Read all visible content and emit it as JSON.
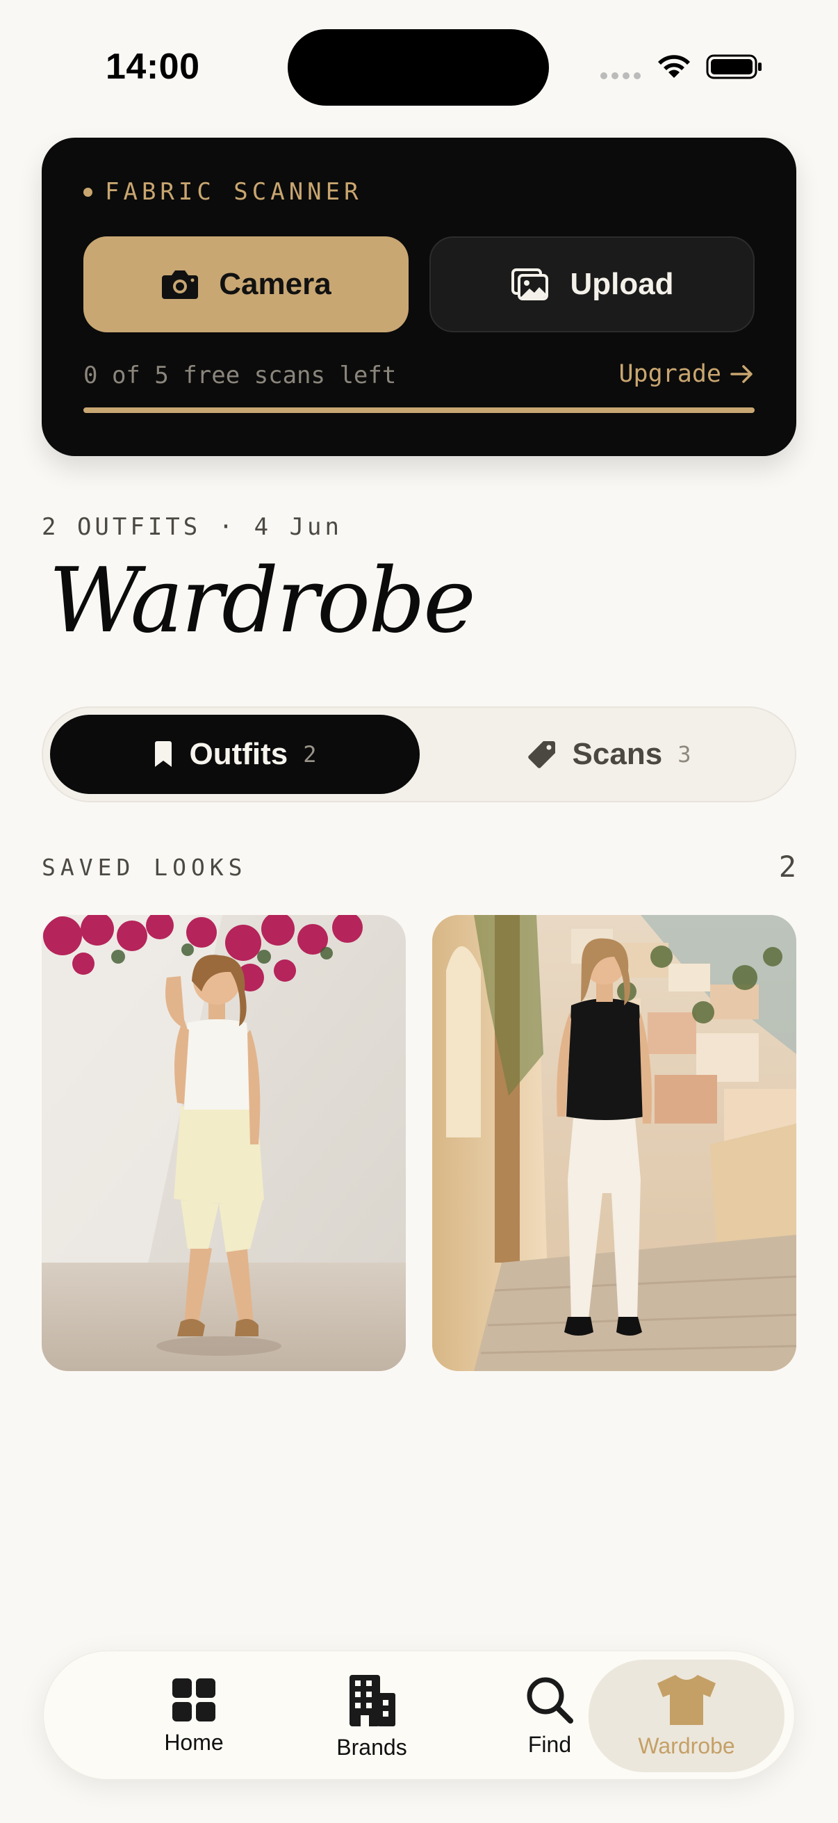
{
  "status_bar": {
    "time": "14:00"
  },
  "scanner": {
    "label": "FABRIC SCANNER",
    "camera_label": "Camera",
    "upload_label": "Upload",
    "scans_left": "0 of 5 free scans left",
    "upgrade_label": "Upgrade",
    "progress_fraction": 1.0,
    "accent_color": "#c9a773"
  },
  "header": {
    "meta": "2 OUTFITS · 4 Jun",
    "title": "Wardrobe"
  },
  "segments": [
    {
      "label": "Outfits",
      "count": "2",
      "icon": "bookmark-icon",
      "selected": true
    },
    {
      "label": "Scans",
      "count": "3",
      "icon": "tag-icon",
      "selected": false
    }
  ],
  "saved_looks": {
    "label": "SAVED LOOKS",
    "count": "2",
    "items": [
      {
        "image": "woman in white tank top and pale yellow shorts against white wall with pink bougainvillea"
      },
      {
        "image": "woman in black sleeveless blouse and white trousers on steps of a hillside village"
      }
    ]
  },
  "tab_bar": {
    "items": [
      {
        "label": "Home",
        "icon": "grid-icon",
        "active": false
      },
      {
        "label": "Brands",
        "icon": "building-icon",
        "active": false
      },
      {
        "label": "Find",
        "icon": "search-icon",
        "active": false
      },
      {
        "label": "Wardrobe",
        "icon": "tshirt-icon",
        "active": true
      }
    ],
    "active_color": "#c4a067"
  }
}
